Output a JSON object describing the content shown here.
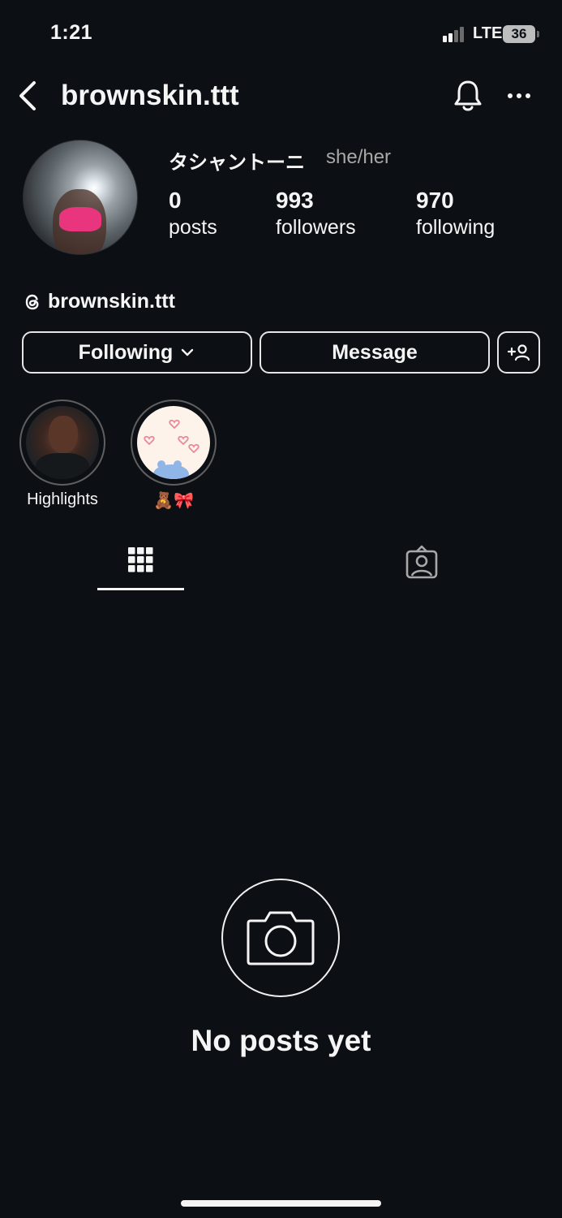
{
  "status_bar": {
    "time": "1:21",
    "network": "LTE",
    "battery": "36"
  },
  "header": {
    "username": "brownskin.ttt"
  },
  "profile": {
    "display_name": "タシャントーニ",
    "pronouns": "she/her",
    "stats": [
      {
        "value": "0",
        "label": "posts"
      },
      {
        "value": "993",
        "label": "followers"
      },
      {
        "value": "970",
        "label": "following"
      }
    ],
    "threads_handle": "brownskin.ttt"
  },
  "actions": {
    "following_label": "Following",
    "message_label": "Message"
  },
  "highlights": [
    {
      "label": "Highlights"
    },
    {
      "label": "🧸🎀"
    }
  ],
  "tabs": [
    {
      "icon": "grid-icon",
      "active": true
    },
    {
      "icon": "tagged-icon",
      "active": false
    }
  ],
  "empty_state": {
    "icon": "camera-icon",
    "text": "No posts yet"
  },
  "colors": {
    "background": "#0c1014",
    "text": "#f5f5f5",
    "muted": "#a8a8a8",
    "border": "#e6e6e6"
  }
}
